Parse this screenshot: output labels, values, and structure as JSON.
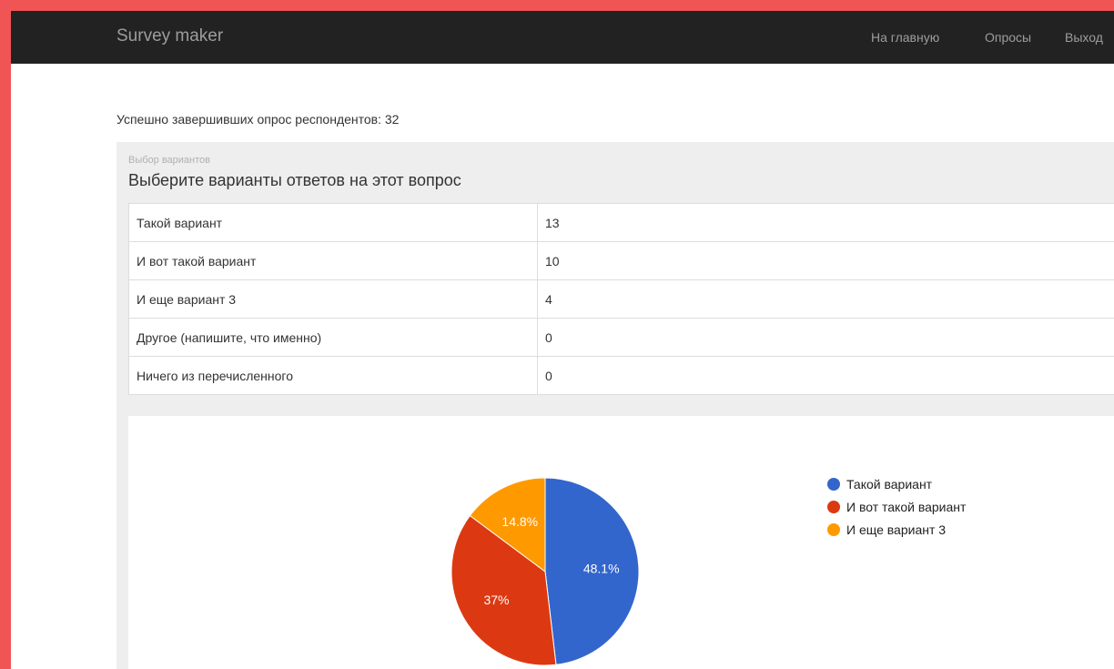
{
  "navbar": {
    "brand": "Survey maker",
    "links": [
      "На главную",
      "Опросы",
      "Выход"
    ]
  },
  "summary": {
    "respondents_text": "Успешно завершивших опрос респондентов: 32"
  },
  "question": {
    "type_label": "Выбор вариантов",
    "title": "Выберите варианты ответов на этот вопрос",
    "rows": [
      {
        "option": "Такой вариант",
        "count": "13"
      },
      {
        "option": "И вот такой вариант",
        "count": "10"
      },
      {
        "option": "И еще вариант 3",
        "count": "4"
      },
      {
        "option": "Другое (напишите, что именно)",
        "count": "0"
      },
      {
        "option": "Ничего из перечисленного",
        "count": "0"
      }
    ]
  },
  "chart_data": {
    "type": "pie",
    "categories": [
      "Такой вариант",
      "И вот такой вариант",
      "И еще вариант 3"
    ],
    "values": [
      13,
      10,
      4
    ],
    "labels": [
      "48.1%",
      "37%",
      "14.8%"
    ],
    "colors": [
      "#3366cc",
      "#dc3912",
      "#ff9900"
    ],
    "legend": "right"
  }
}
